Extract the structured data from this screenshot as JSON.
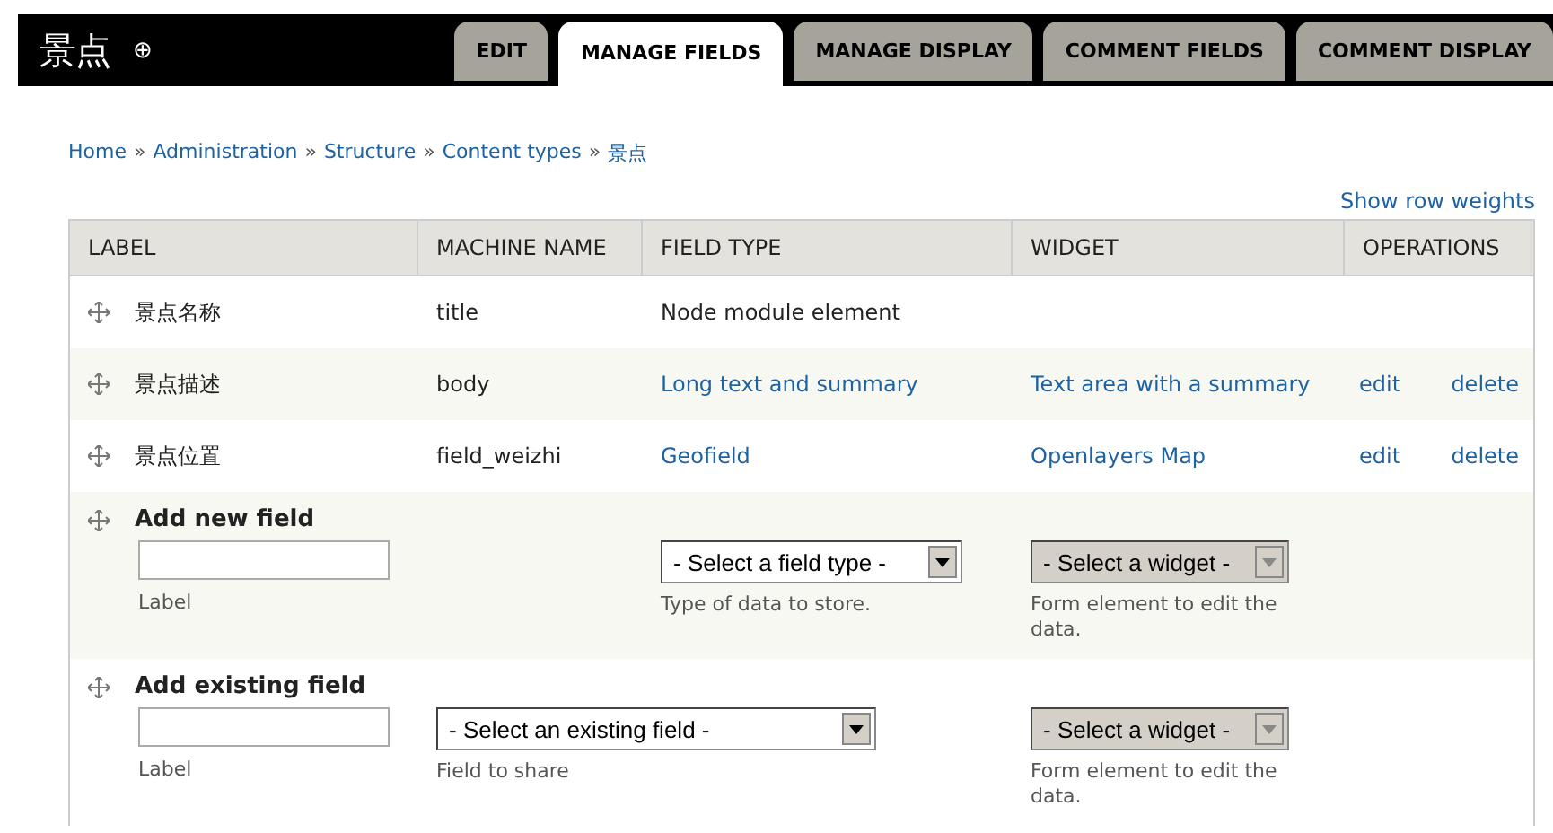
{
  "title": "景点",
  "add_symbol": "⊕",
  "tabs": [
    {
      "label": "EDIT",
      "selected": false
    },
    {
      "label": "MANAGE FIELDS",
      "selected": true
    },
    {
      "label": "MANAGE DISPLAY",
      "selected": false
    },
    {
      "label": "COMMENT FIELDS",
      "selected": false
    },
    {
      "label": "COMMENT DISPLAY",
      "selected": false
    }
  ],
  "breadcrumb": {
    "separator": "»",
    "items": [
      "Home",
      "Administration",
      "Structure",
      "Content types",
      "景点"
    ]
  },
  "show_row_weights": "Show row weights",
  "table": {
    "columns": [
      "LABEL",
      "MACHINE NAME",
      "FIELD TYPE",
      "WIDGET",
      "OPERATIONS"
    ],
    "rows": [
      {
        "kind": "locked",
        "label": "景点名称",
        "machine_name": "title",
        "field_type": "Node module element"
      },
      {
        "kind": "field",
        "label": "景点描述",
        "machine_name": "body",
        "field_type": "Long text and summary",
        "widget": "Text area with a summary",
        "edit": "edit",
        "delete": "delete"
      },
      {
        "kind": "field",
        "label": "景点位置",
        "machine_name": "field_weizhi",
        "field_type": "Geofield",
        "widget": "Openlayers Map",
        "edit": "edit",
        "delete": "delete"
      }
    ],
    "add_new": {
      "title": "Add new field",
      "label_hint": "Label",
      "type_select": "- Select a field type -",
      "type_hint": "Type of data to store.",
      "widget_select": {
        "value": "- Select a widget -",
        "disabled": true
      },
      "widget_hint": "Form element to edit the data."
    },
    "add_existing": {
      "title": "Add existing field",
      "label_hint": "Label",
      "field_select": "- Select an existing field -",
      "field_hint": "Field to share",
      "widget_select": {
        "value": "- Select a widget -",
        "disabled": true
      },
      "widget_hint": "Form element to edit the data."
    }
  }
}
